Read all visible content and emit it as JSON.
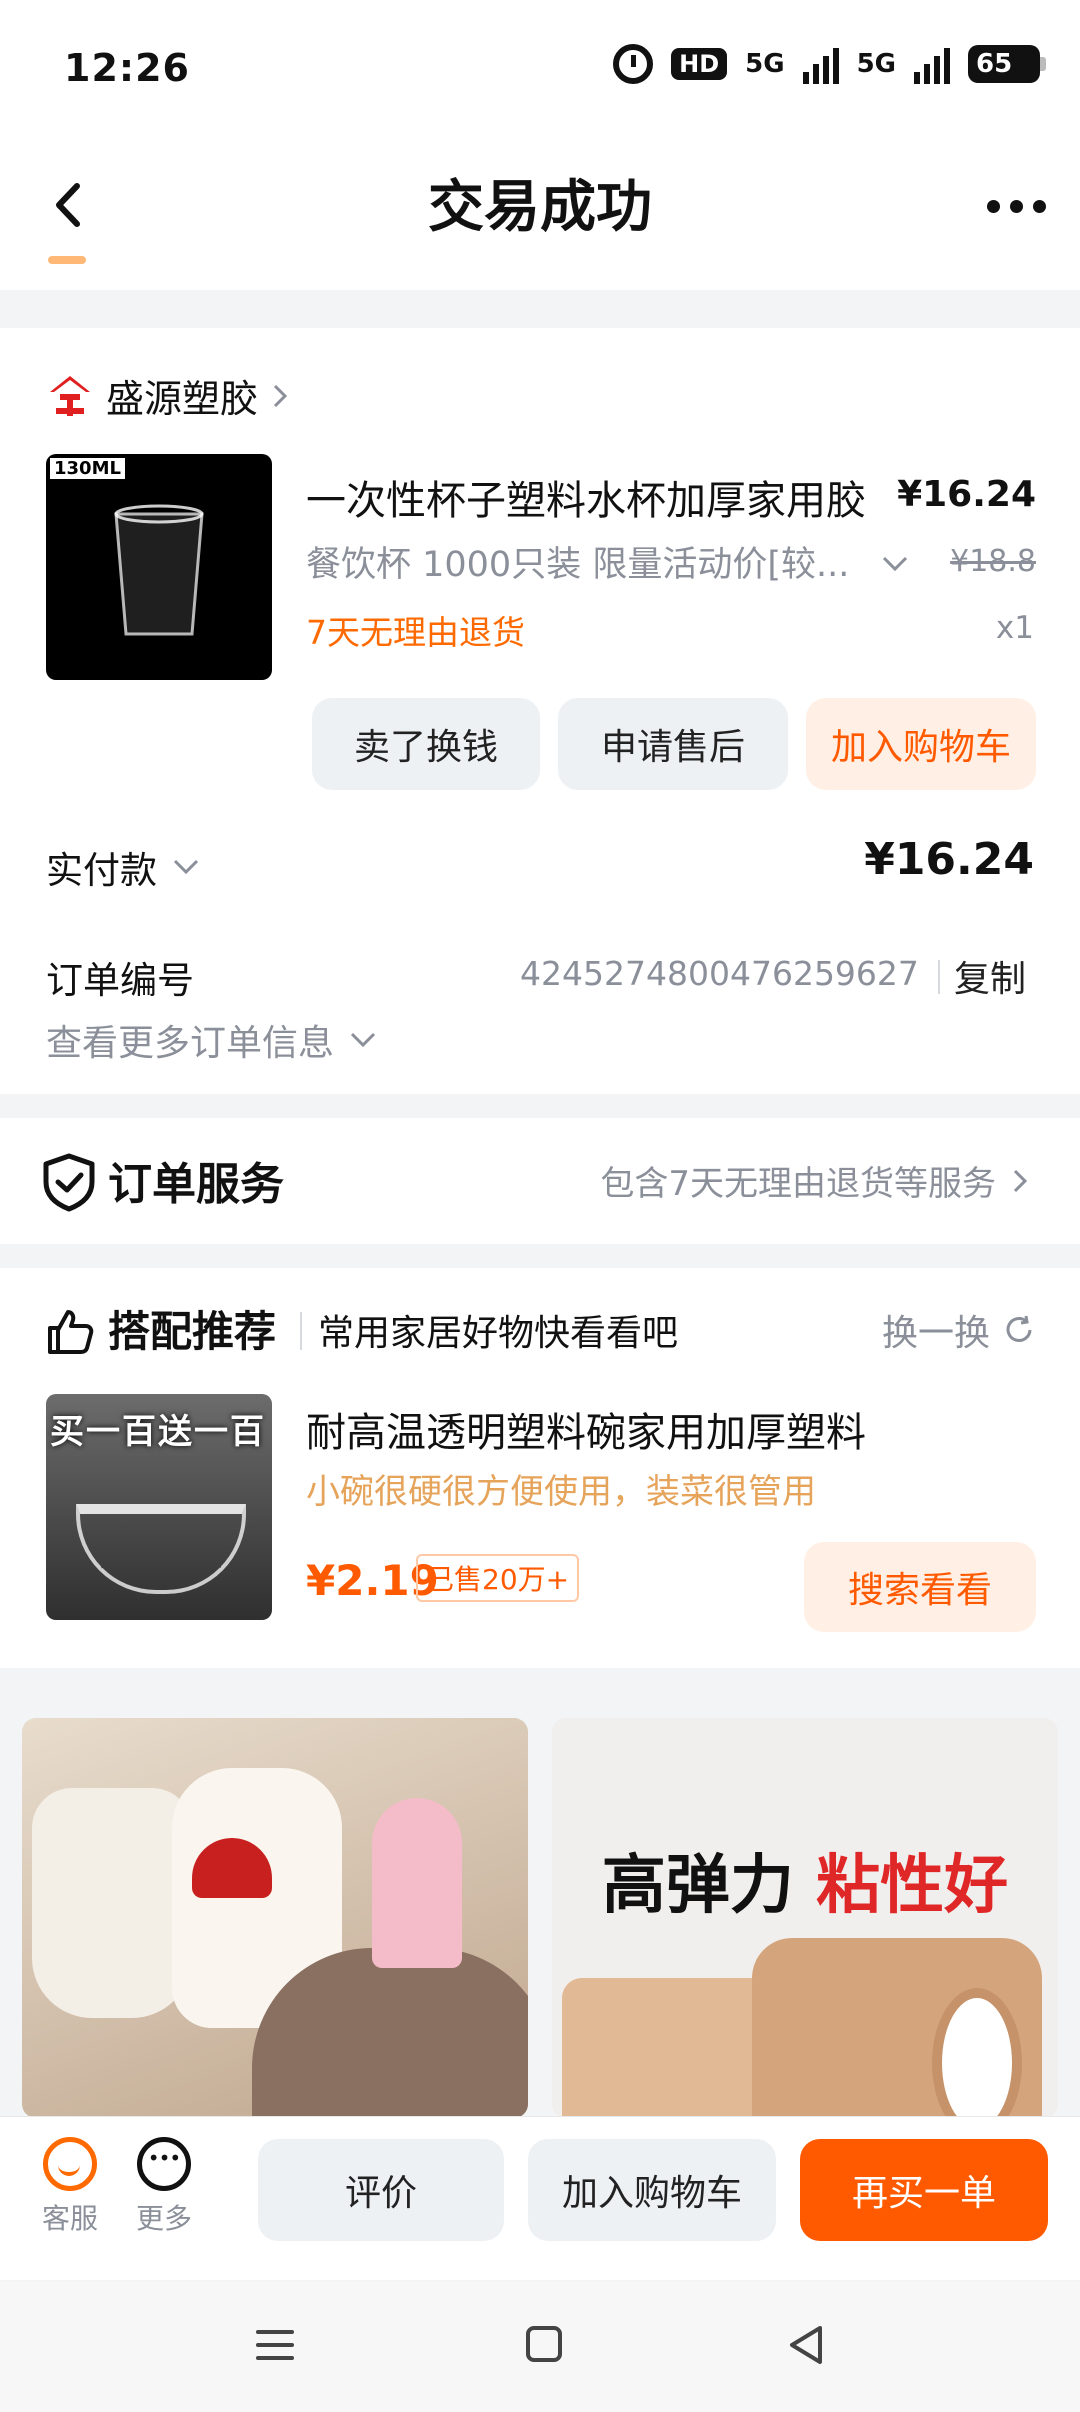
{
  "status_bar": {
    "time": "12:26",
    "hd": "HD",
    "network1": "5G",
    "network2": "5G",
    "battery": "65"
  },
  "header": {
    "title": "交易成功"
  },
  "order": {
    "shop_name": "盛源塑胶",
    "product": {
      "title": "一次性杯子塑料水杯加厚家用胶",
      "spec": "餐饮杯 1000只装 限量活动价[较...",
      "price": "¥16.24",
      "original_price": "¥18.8",
      "return_policy": "7天无理由退货",
      "quantity": "x1",
      "image_label": "130ML"
    },
    "actions": {
      "sell": "卖了换钱",
      "after_sales": "申请售后",
      "add_cart": "加入购物车"
    },
    "paid_label": "实付款",
    "paid_amount": "¥16.24",
    "order_no_label": "订单编号",
    "order_no": "4245274800476259627",
    "copy": "复制",
    "more_info": "查看更多订单信息"
  },
  "service": {
    "title": "订单服务",
    "desc": "包含7天无理由退货等服务"
  },
  "recommend": {
    "title": "搭配推荐",
    "subtitle": "常用家居好物快看看吧",
    "refresh": "换一换",
    "item": {
      "image_banner": "买一百送一百",
      "name": "耐高温透明塑料碗家用加厚塑料",
      "desc": "小碗很硬很方便使用，装菜很管用",
      "price": "¥2.19",
      "sold": "已售20万+",
      "button": "搜索看看"
    }
  },
  "feed": {
    "item2_headline_a": "高弹力",
    "item2_headline_b": "粘性好"
  },
  "bottom_bar": {
    "service_label": "客服",
    "more_label": "更多",
    "review": "评价",
    "add_cart": "加入购物车",
    "rebuy": "再买一单"
  },
  "colors": {
    "accent": "#ff5a00",
    "accent_light": "#ffefe4",
    "muted": "#8a8f99"
  },
  "icons": [
    "back-icon",
    "more-dots-icon",
    "shop-logo-icon",
    "shield-check-icon",
    "thumbs-up-icon",
    "refresh-icon",
    "service-face-icon",
    "more-circle-icon"
  ]
}
